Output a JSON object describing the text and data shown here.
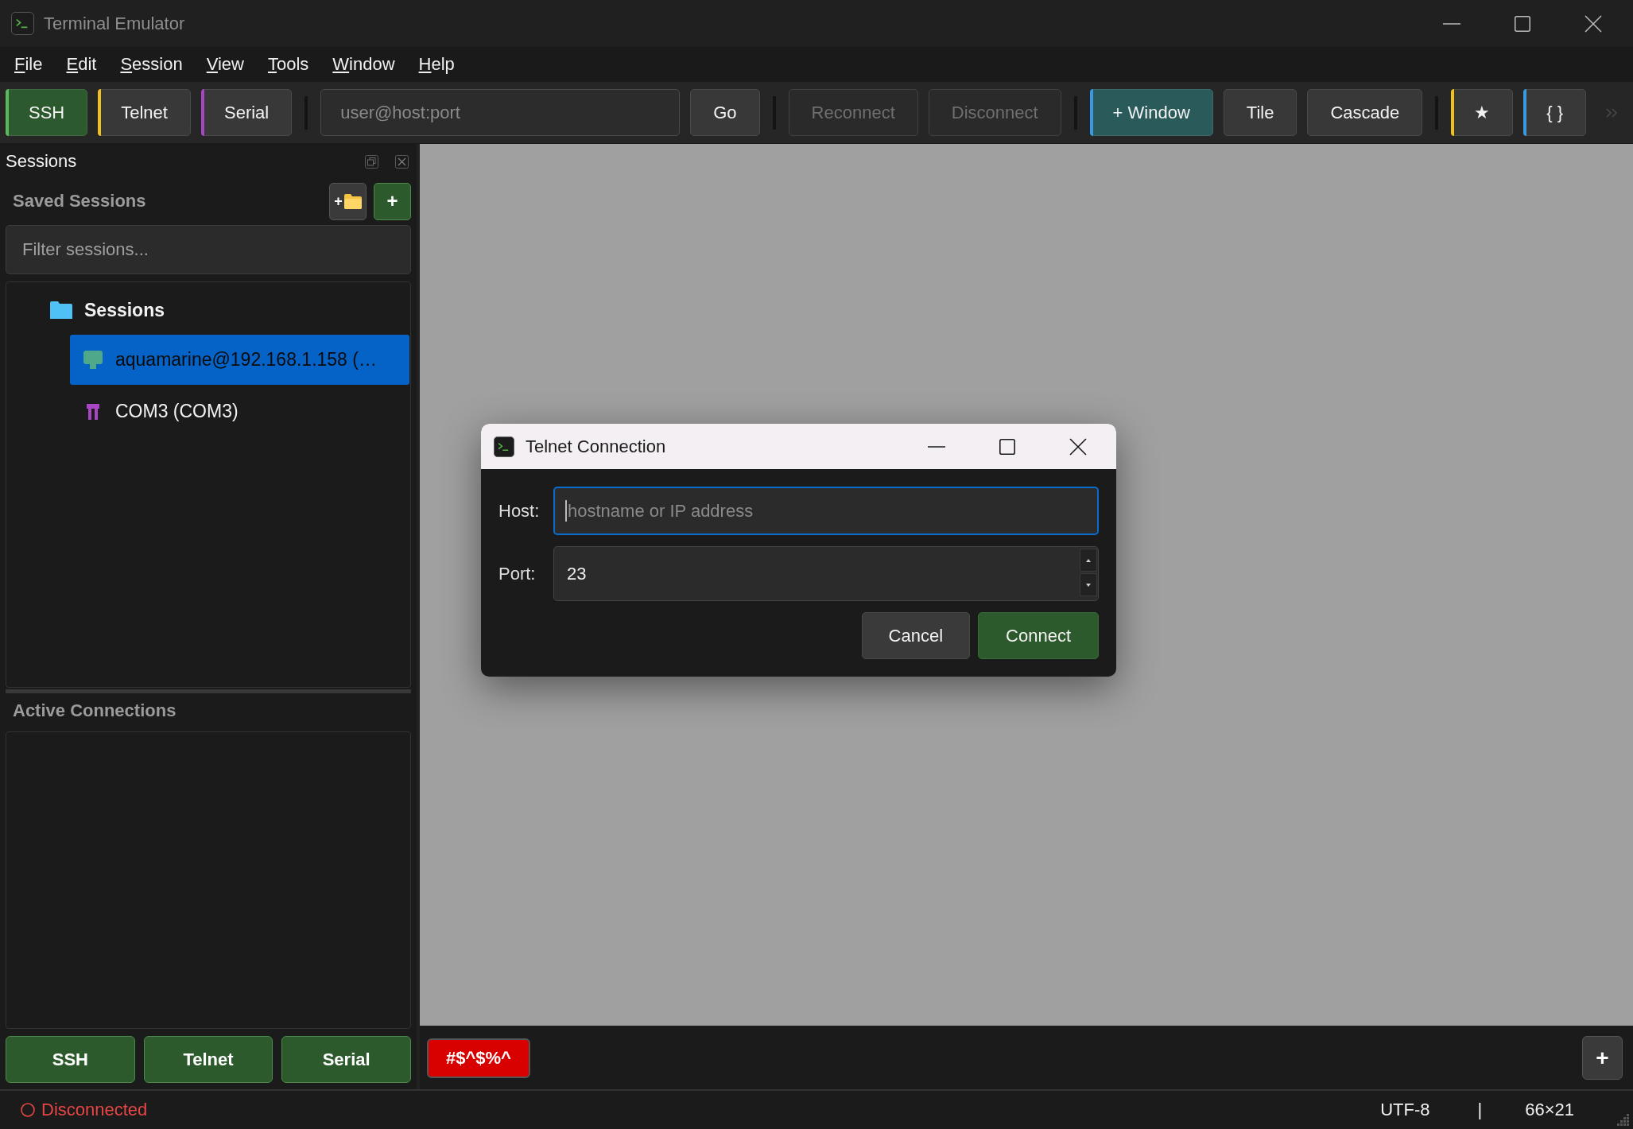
{
  "window": {
    "title": "Terminal Emulator"
  },
  "menu": [
    "File",
    "Edit",
    "Session",
    "View",
    "Tools",
    "Window",
    "Help"
  ],
  "toolbar": {
    "items": [
      {
        "kind": "success",
        "label": "SSH",
        "color": "#5cb85c",
        "disabled": false
      },
      {
        "kind": "button",
        "label": "Telnet",
        "color": "#f0c020",
        "disabled": false
      },
      {
        "kind": "button",
        "label": "Serial",
        "color": "#a846c4",
        "disabled": false
      },
      {
        "kind": "separator"
      },
      {
        "kind": "field",
        "placeholder": "user@host:port"
      },
      {
        "kind": "button",
        "label": "Go",
        "disabled": false
      },
      {
        "kind": "separator"
      },
      {
        "kind": "button",
        "label": "Reconnect",
        "disabled": true
      },
      {
        "kind": "button",
        "label": "Disconnect",
        "disabled": true
      },
      {
        "kind": "separator"
      },
      {
        "kind": "info",
        "label": "+ Window",
        "color": "#3a9ae0",
        "disabled": false
      },
      {
        "kind": "button",
        "label": "Tile",
        "disabled": false
      },
      {
        "kind": "button",
        "label": "Cascade",
        "disabled": false
      },
      {
        "kind": "separator"
      },
      {
        "kind": "button",
        "label": "★",
        "color": "#f0c020",
        "disabled": false
      },
      {
        "kind": "button",
        "label": "{ }",
        "color": "#3a9ae0",
        "disabled": false
      },
      {
        "kind": "overflow"
      }
    ]
  },
  "sessions_panel": {
    "title": "Sessions",
    "saved_heading": "Saved Sessions",
    "saved_actions": [
      {
        "kind": "folder",
        "label": "+"
      },
      {
        "kind": "session",
        "label": "+"
      }
    ],
    "filter": {
      "placeholder": "Filter sessions..."
    },
    "tree": [
      {
        "kind": "folder",
        "label": "Sessions",
        "selected": false,
        "children": [
          {
            "kind": "ssh",
            "label": "aquamarine@192.168.1.158 (…",
            "selected": true
          },
          {
            "kind": "serial",
            "label": "COM3 (COM3)",
            "selected": false
          }
        ]
      }
    ],
    "active_heading": "Active Connections",
    "quick_buttons": [
      "SSH",
      "Telnet",
      "Serial"
    ]
  },
  "workspace": {
    "dialog": {
      "title": "Telnet Connection",
      "fields": [
        {
          "kind": "text",
          "label": "Host:",
          "placeholder": "hostname or IP address",
          "focused": true
        },
        {
          "kind": "spin",
          "label": "Port:",
          "value": "23",
          "focused": false
        }
      ],
      "buttons": [
        {
          "label": "Cancel",
          "primary": false
        },
        {
          "label": "Connect",
          "primary": true
        }
      ]
    }
  },
  "tabs": [
    {
      "label": "#$^$%^",
      "selected": true
    }
  ],
  "new_tab_button": {
    "label": "+"
  },
  "status_bar": {
    "connection": {
      "label": "Disconnected",
      "connected": false
    },
    "encoding": "UTF-8",
    "separator": "|",
    "size": "66×21"
  }
}
